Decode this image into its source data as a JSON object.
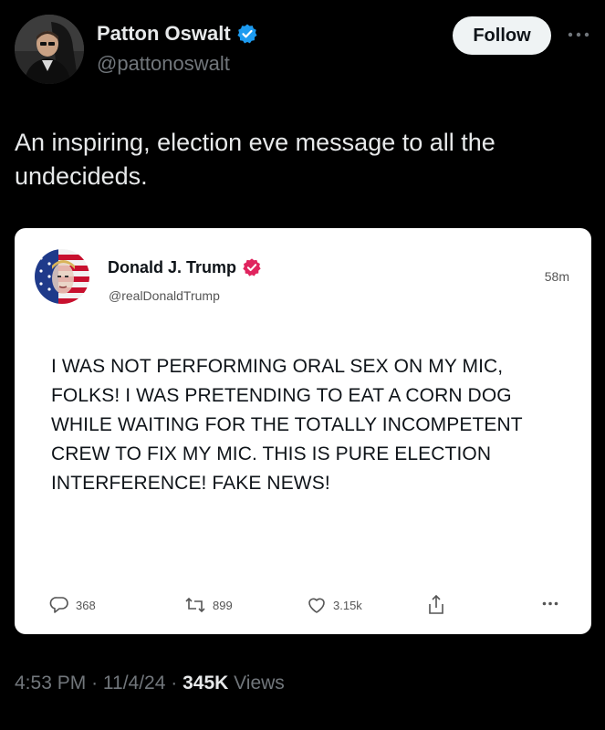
{
  "author": {
    "name": "Patton Oswalt",
    "handle": "@pattonoswalt",
    "verified": true,
    "avatar_icon": "profile-photo"
  },
  "follow_label": "Follow",
  "more_icon": "more-options-icon",
  "tweet_text": "An inspiring, election eve message to all the undecideds.",
  "embedded_post": {
    "name": "Donald J. Trump",
    "handle": "@realDonaldTrump",
    "time_ago": "58m",
    "verified_color": "#e0245e",
    "avatar_icon": "flag-portrait",
    "body": "I WAS NOT PERFORMING ORAL SEX ON MY MIC, FOLKS! I WAS PRETENDING TO EAT A CORN DOG WHILE WAITING FOR THE TOTALLY INCOMPETENT CREW TO FIX MY MIC. THIS IS PURE ELECTION INTERFERENCE! FAKE NEWS!",
    "actions": {
      "replies": "368",
      "reposts": "899",
      "likes": "3.15k"
    }
  },
  "meta": {
    "time": "4:53 PM",
    "date": "11/4/24",
    "separator": "·",
    "views_count": "345K",
    "views_label": "Views"
  },
  "colors": {
    "background": "#000000",
    "verified_blue": "#1d9bf0",
    "card_bg": "#ffffff",
    "muted": "#71767b"
  }
}
